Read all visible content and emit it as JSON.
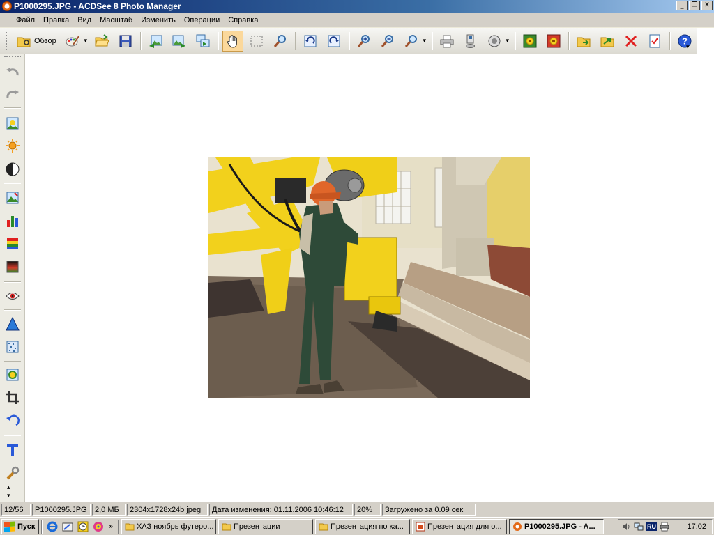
{
  "window": {
    "title": "P1000295.JPG - ACDSee 8 Photo Manager",
    "buttons": [
      "_",
      "❐",
      "✕"
    ]
  },
  "menu": [
    "Файл",
    "Правка",
    "Вид",
    "Масштаб",
    "Изменить",
    "Операции",
    "Справка"
  ],
  "toolbar": {
    "browse_label": "Обзор",
    "items": [
      "browse",
      "edit",
      "open",
      "save",
      "prev",
      "next",
      "slideshow",
      "hand",
      "select",
      "zoom",
      "rotate-left",
      "rotate-right",
      "zoom-in",
      "zoom-out",
      "zoom",
      "print",
      "scan",
      "sound",
      "wallpaper-center",
      "wallpaper-tile",
      "copy-to",
      "move-to",
      "delete",
      "properties",
      "help"
    ]
  },
  "left_tools": [
    "undo",
    "redo",
    "image",
    "brightness",
    "contrast",
    "levels",
    "histogram",
    "color-balance",
    "gradient",
    "red-eye",
    "sharpen",
    "noise",
    "effects",
    "crop",
    "rotate",
    "text",
    "settings"
  ],
  "photo": {
    "description_icon": "industrial-worker-photo"
  },
  "status": {
    "index": "12/56",
    "filename": "P1000295.JPG",
    "size": "2,0 МБ",
    "dimensions": "2304x1728x24b jpeg",
    "modified": "Дата изменения: 01.11.2006 10:46:12",
    "zoom": "20%",
    "load_time": "Загружено за 0.09 сек"
  },
  "taskbar": {
    "start_label": "Пуск",
    "quicklaunch_more": "»",
    "tasks": [
      {
        "label": "ХАЗ ноябрь футеро...",
        "icon": "folder-icon",
        "active": false
      },
      {
        "label": "Презентации",
        "icon": "folder-icon",
        "active": false
      },
      {
        "label": "Презентация по ка...",
        "icon": "folder-icon",
        "active": false
      },
      {
        "label": "Презентация для о...",
        "icon": "powerpoint-icon",
        "active": false
      },
      {
        "label": "P1000295.JPG - A...",
        "icon": "acdsee-icon",
        "active": true
      }
    ],
    "tray": {
      "lang": "RU",
      "time": "17:02"
    }
  },
  "colors": {
    "titlebar_start": "#0a246a",
    "titlebar_end": "#a6caf0",
    "chrome": "#d4d0c8",
    "active_tool": "#fbd89b"
  }
}
